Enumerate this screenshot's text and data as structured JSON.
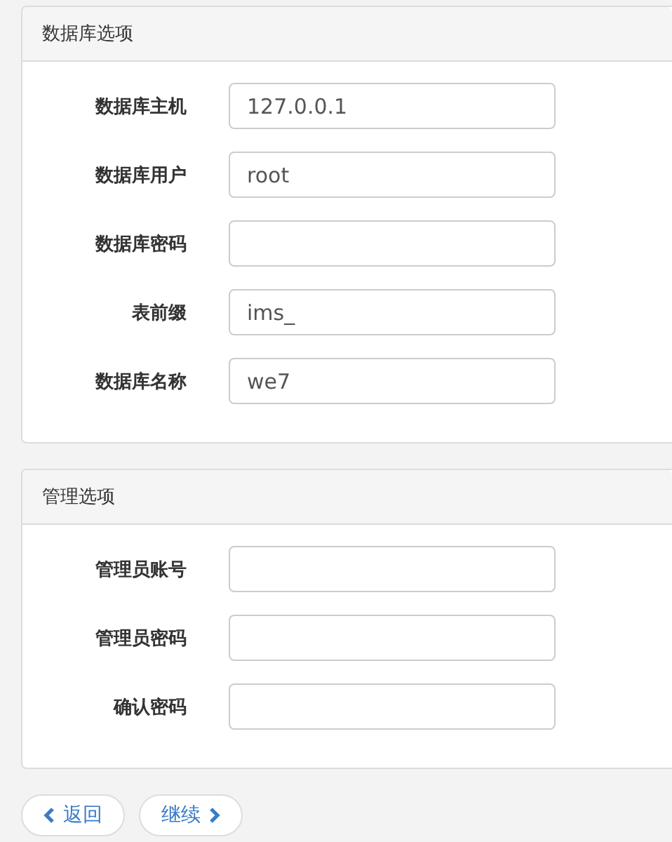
{
  "panels": [
    {
      "title": "数据库选项",
      "fields": [
        {
          "label": "数据库主机",
          "value": "127.0.0.1"
        },
        {
          "label": "数据库用户",
          "value": "root"
        },
        {
          "label": "数据库密码"
        },
        {
          "label": "表前缀",
          "value": "ims_"
        },
        {
          "label": "数据库名称",
          "value": "we7"
        }
      ]
    },
    {
      "title": "管理选项",
      "fields": [
        {
          "label": "管理员账号"
        },
        {
          "label": "管理员密码"
        },
        {
          "label": "确认密码"
        }
      ]
    }
  ],
  "buttons": [
    {
      "label": "返回",
      "kind": "back"
    },
    {
      "label": "继续",
      "kind": "next"
    }
  ]
}
